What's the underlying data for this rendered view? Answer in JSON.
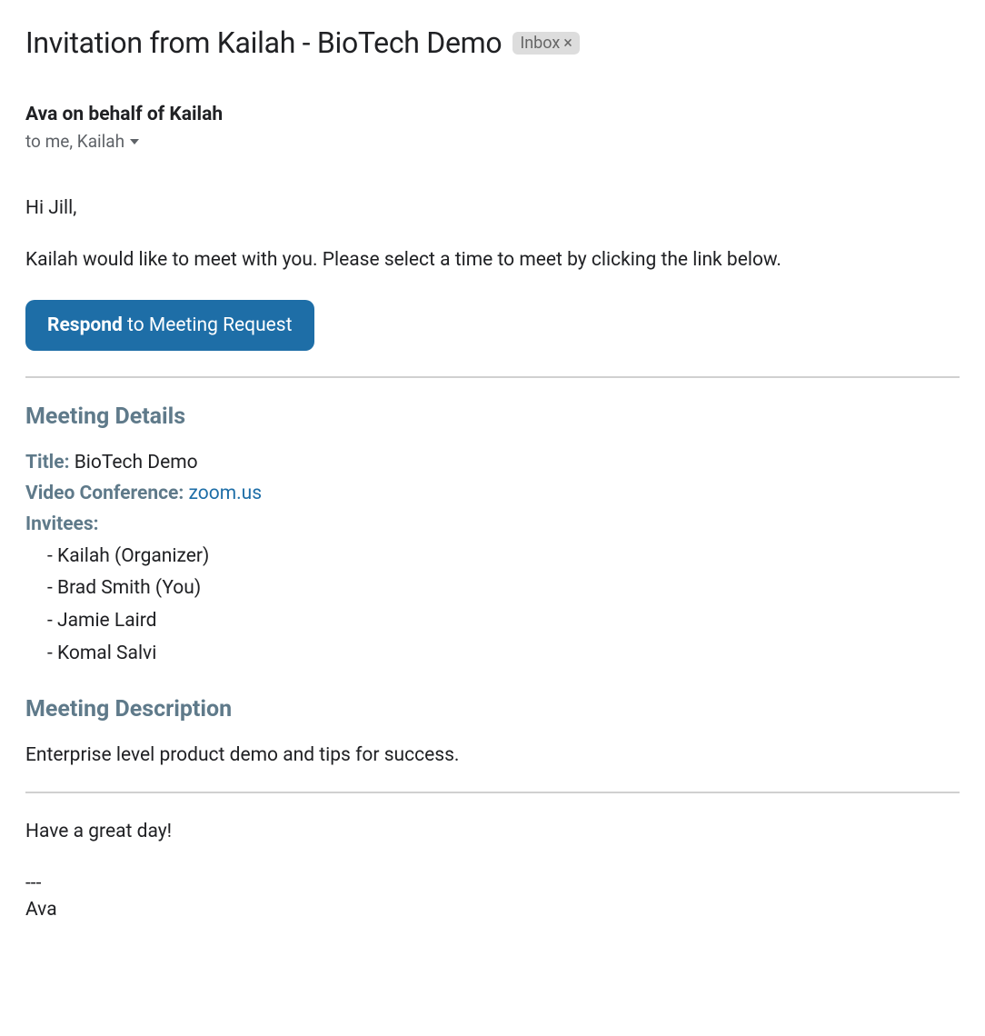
{
  "subject": "Invitation from Kailah - BioTech Demo",
  "inbox_badge": {
    "label": "Inbox"
  },
  "sender": "Ava on behalf of Kailah",
  "recipients": "to me, Kailah",
  "body": {
    "greeting": "Hi Jill,",
    "intro": "Kailah would like to meet with you. Please select a time to meet by clicking the link below.",
    "respond_button": {
      "bold": "Respond",
      "normal": " to Meeting Request"
    }
  },
  "meeting_details": {
    "heading": "Meeting Details",
    "title_label": "Title:",
    "title_value": "BioTech Demo",
    "video_label": "Video Conference:",
    "video_value": "zoom.us",
    "invitees_label": "Invitees:",
    "invitees": [
      "Kailah (Organizer)",
      "Brad Smith (You)",
      "Jamie Laird",
      "Komal Salvi"
    ]
  },
  "meeting_description": {
    "heading": "Meeting Description",
    "text": "Enterprise level product demo and tips for success."
  },
  "closing": {
    "line1": "Have a great day!",
    "dashes": "---",
    "signature": "Ava"
  }
}
